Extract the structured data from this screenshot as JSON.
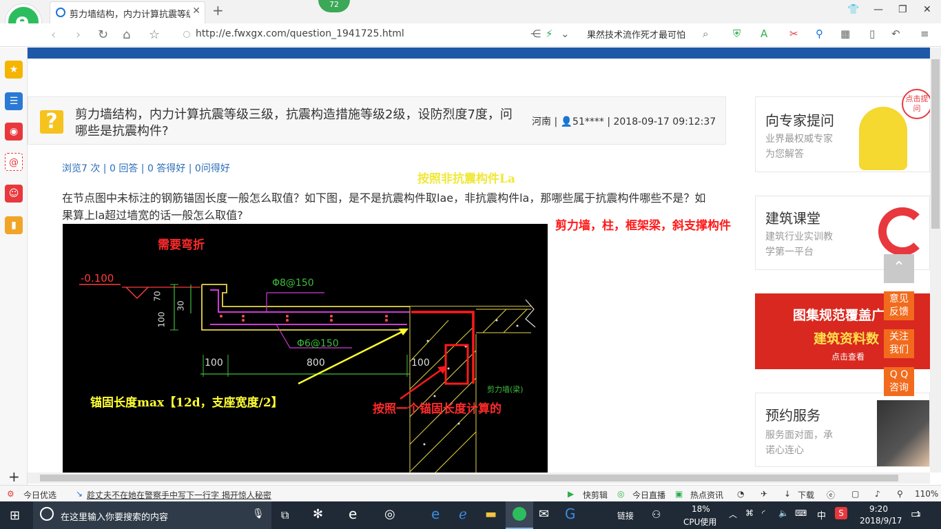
{
  "browser": {
    "tab_title": "剪力墙结构，内力计算抗震等级三级，",
    "badge": "72",
    "url": "http://e.fwxgx.com/question_1941725.html",
    "search_text": "果然技术流作死才最可怕"
  },
  "question": {
    "title": "剪力墙结构，内力计算抗震等级三级，抗震构造措施等级2级，设防烈度7度，问哪些是抗震构件?",
    "meta": "河南 | 👤51**** | 2018-09-17 09:12:37",
    "stats": "浏览7 次 | 0 回答 | 0 答得好 | 0问得好",
    "body": "在节点图中未标注的钢筋锚固长度一般怎么取值？如下图，是不是抗震构件取lae，非抗震构件la，那哪些属于抗震构件哪些不是？如果算上la超过墙宽的话一般怎么取值?"
  },
  "annotations": {
    "yellow_top": "按照非抗震构件La",
    "red_right": "剪力墙，柱，框架梁，斜支撑构件",
    "need_bend": "需要弯折",
    "anchor_len": "锚固长度max【12d，支座宽度/2】",
    "by_anchor": "按照一个锚固长度计算的"
  },
  "cad_labels": {
    "elev": "-0.100",
    "rebar1": "Φ8@150",
    "rebar2": "Φ6@150",
    "d70": "70",
    "d30": "30",
    "d100v": "100",
    "d100": "100",
    "d800": "800",
    "d100b": "100",
    "wall": "剪力墙(梁)"
  },
  "sidebar_cards": [
    {
      "title": "向专家提问",
      "sub1": "业界最权威专家",
      "sub2": "为您解答"
    },
    {
      "title": "建筑课堂",
      "sub1": "建筑行业实训教",
      "sub2": "学第一平台"
    },
    {
      "title": "图集规范覆盖广",
      "sub1": "建筑资料数",
      "sub2": "点击查看"
    },
    {
      "title": "预约服务",
      "sub1": "服务面对面，承",
      "sub2": "诺心连心"
    }
  ],
  "ask_bubble": "点击提问",
  "float_tabs": {
    "feedback1": "意见",
    "feedback2": "反馈",
    "follow1": "关注",
    "follow2": "我们",
    "qq1": "Q Q",
    "qq2": "咨询"
  },
  "status_bar": {
    "today": "今日优选",
    "news": "趁丈夫不在她在警察手中写下一行字 揭开惊人秘密",
    "quickedit": "快剪辑",
    "live": "今日直播",
    "hot": "热点资讯",
    "download": "下载",
    "zoom": "110%"
  },
  "taskbar": {
    "search_placeholder": "在这里输入你要搜索的内容",
    "link": "链接",
    "cpu_pct": "18%",
    "cpu_label": "CPU使用",
    "ime": "中",
    "time": "9:20",
    "date": "2018/9/17",
    "notif": "1"
  }
}
